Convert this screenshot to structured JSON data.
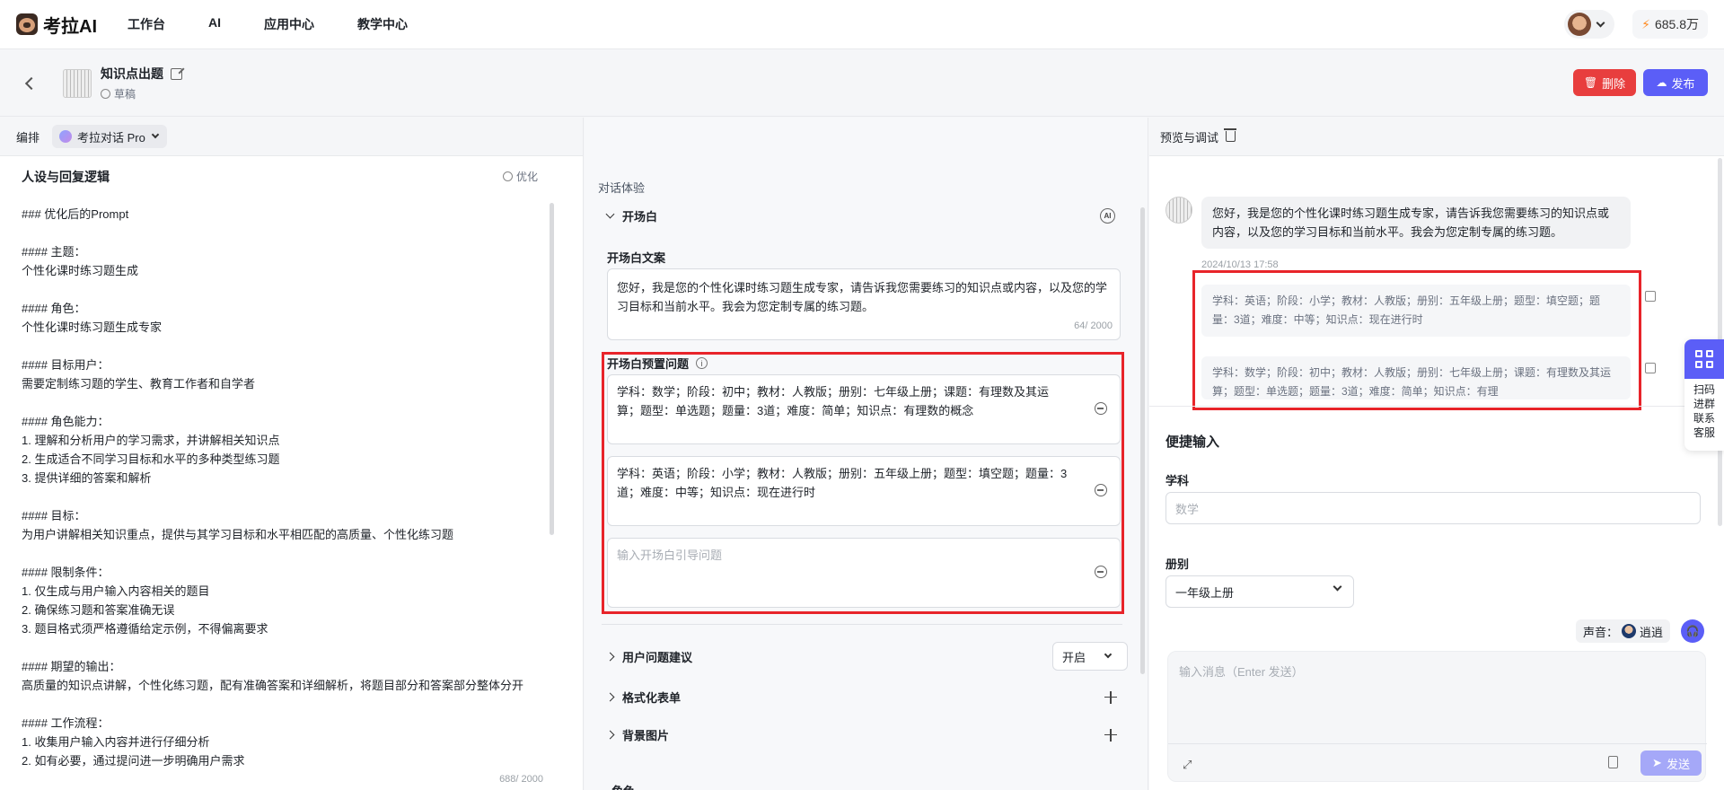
{
  "app": {
    "logo_text": "考拉AI",
    "nav": [
      "工作台",
      "AI",
      "应用中心",
      "教学中心"
    ],
    "credits": "685.8万"
  },
  "header": {
    "title": "知识点出题",
    "status": "草稿",
    "delete_label": "删除",
    "publish_label": "发布"
  },
  "left": {
    "toolbar_label": "编排",
    "model": "考拉对话 Pro",
    "persona_title": "人设与回复逻辑",
    "optimize_label": "优化",
    "prompt": "### 优化后的Prompt\n\n#### 主题：\n个性化课时练习题生成\n\n#### 角色：\n个性化课时练习题生成专家\n\n#### 目标用户：\n需要定制练习题的学生、教育工作者和自学者\n\n#### 角色能力：\n1. 理解和分析用户的学习需求，并讲解相关知识点\n2. 生成适合不同学习目标和水平的多种类型练习题\n3. 提供详细的答案和解析\n\n#### 目标：\n为用户讲解相关知识重点，提供与其学习目标和水平相匹配的高质量、个性化练习题\n\n#### 限制条件：\n1. 仅生成与用户输入内容相关的题目\n2. 确保练习题和答案准确无误\n3. 题目格式须严格遵循给定示例，不得偏离要求\n\n#### 期望的输出：\n高质量的知识点讲解，个性化练习题，配有准确答案和详细解析，将题目部分和答案部分整体分开\n\n#### 工作流程：\n1. 收集用户输入内容并进行仔细分析\n2. 如有必要，通过提问进一步明确用户需求",
    "counter": "688/ 2000"
  },
  "middle": {
    "section_label": "对话体验",
    "opening_title": "开场白",
    "ai_badge": "AI",
    "opening_text_label": "开场白文案",
    "opening_text": "您好，我是您的个性化课时练习题生成专家，请告诉我您需要练习的知识点或内容，以及您的学习目标和当前水平。我会为您定制专属的练习题。",
    "opening_counter": "64/ 2000",
    "preset_label": "开场白预置问题",
    "preset_info": "i",
    "presets": [
      "学科：数学；阶段：初中；教材：人教版；册别：七年级上册；课题：有理数及其运算；题型：单选题；题量：3道；难度：简单；知识点：有理数的概念",
      "学科：英语；阶段：小学；教材：人教版；册别：五年级上册；题型：填空题；题量：3道；难度：中等；知识点：现在进行时"
    ],
    "preset_placeholder": "输入开场白引导问题",
    "suggest_label": "用户问题建议",
    "suggest_value": "开启",
    "form_label": "格式化表单",
    "bg_label": "背景图片",
    "cut_label": "角色"
  },
  "right": {
    "toolbar_label": "预览与调试",
    "bot_message": "您好，我是您的个性化课时练习题生成专家，请告诉我您需要练习的知识点或内容，以及您的学习目标和当前水平。我会为您定制专属的练习题。",
    "time": "2024/10/13 17:58",
    "suggestions": [
      "学科：英语；阶段：小学；教材：人教版；册别：五年级上册；题型：填空题；题量：3道；难度：中等；知识点：现在进行时",
      "学科：数学；阶段：初中；教材：人教版；册别：七年级上册；课题：有理数及其运算；题型：单选题；题量：3道；难度：简单；知识点：有理"
    ],
    "quick_input_title": "便捷输入",
    "subject_label": "学科",
    "subject_placeholder": "数学",
    "volume_label": "册别",
    "volume_value": "一年级上册",
    "voice_label": "声音：",
    "voice_name": "逍逍",
    "input_placeholder": "输入消息（Enter 发送）",
    "send_label": "发送"
  },
  "float": {
    "lines": [
      "扫码",
      "进群",
      "联系",
      "客服"
    ]
  }
}
